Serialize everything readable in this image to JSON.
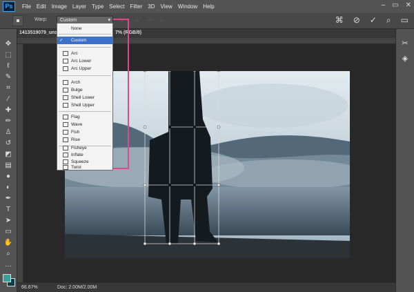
{
  "app": {
    "logo": "Ps",
    "menu": [
      "File",
      "Edit",
      "Image",
      "Layer",
      "Type",
      "Select",
      "Filter",
      "3D",
      "View",
      "Window",
      "Help"
    ]
  },
  "options": {
    "warp_label": "Warp:",
    "warp_value": "Custom"
  },
  "document": {
    "tab_title": "1413519079_uns",
    "tab_suffix": "7% (RGB/8)",
    "zoom": "66.67%",
    "doc_info": "Doc: 2.00M/2.00M"
  },
  "warp_dropdown": {
    "options": [
      "None",
      "Custom",
      "Arc",
      "Arc Lower",
      "Arc Upper",
      "Arch",
      "Bulge",
      "Shell Lower",
      "Shell Upper",
      "Flag",
      "Wave",
      "Fish",
      "Rise",
      "Fisheye",
      "Inflate",
      "Squeeze",
      "Twist"
    ],
    "selected": "Custom"
  },
  "colors": {
    "foreground": "#3a9e9a",
    "background": "#0b3d4a",
    "callout": "#e2478c",
    "selection": "#3b71c9"
  }
}
